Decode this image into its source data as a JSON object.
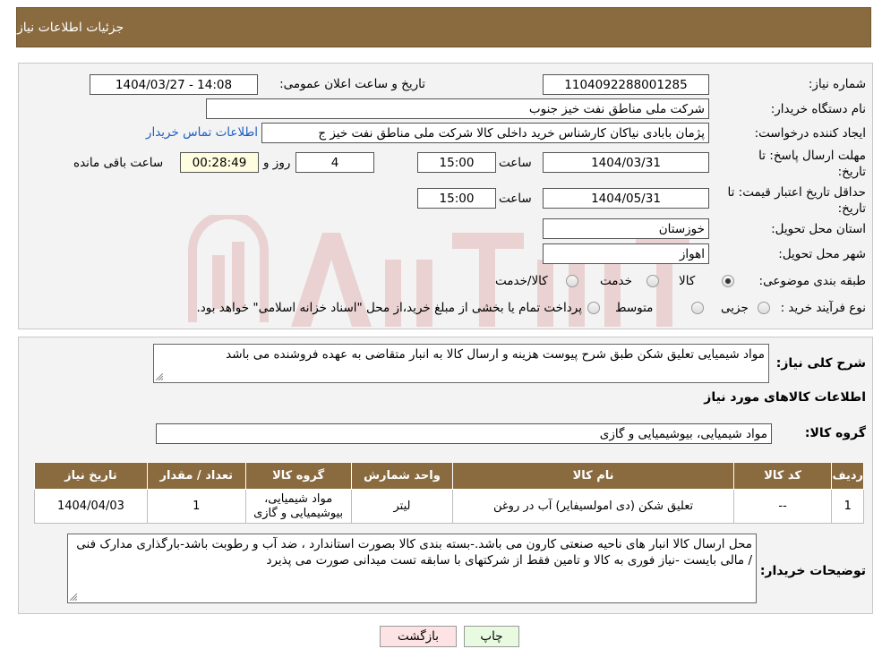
{
  "header": {
    "title": "جزئیات اطلاعات نیاز"
  },
  "need": {
    "number_label": "شماره نیاز:",
    "number": "1104092288001285",
    "announce_label": "تاریخ و ساعت اعلان عمومی:",
    "announce_value": "1404/03/27 - 14:08",
    "buyer_org_label": "نام دستگاه خریدار:",
    "buyer_org": "شرکت ملی مناطق نفت خیز جنوب",
    "creator_label": "ایجاد کننده درخواست:",
    "creator": "پژمان  بابادی نیاکان  کارشناس خرید داخلی کالا  شرکت ملی مناطق نفت خیز ج",
    "contact_link": "اطلاعات تماس خریدار",
    "deadline_label_1": "مهلت ارسال پاسخ: تا",
    "deadline_label_2": "تاریخ:",
    "deadline_date": "1404/03/31",
    "time_word": "ساعت",
    "deadline_time": "15:00",
    "days": "4",
    "days_and": "روز و",
    "remaining": "00:28:49",
    "remaining_label": "ساعت باقی مانده",
    "validity_label_1": "حداقل تاریخ اعتبار قیمت: تا",
    "validity_label_2": "تاریخ:",
    "validity_date": "1404/05/31",
    "validity_time": "15:00",
    "province_label": "استان محل تحویل:",
    "province": "خوزستان",
    "city_label": "شهر محل تحویل:",
    "city": "اهواز",
    "category_label": "طبقه بندی موضوعی:",
    "category_options": [
      "کالا",
      "خدمت",
      "کالا/خدمت"
    ],
    "process_label": "نوع فرآیند خرید :",
    "process_options": [
      "جزیی",
      "متوسط"
    ],
    "process_note": "پرداخت تمام یا بخشی از مبلغ خرید،از محل \"اسناد خزانه اسلامی\" خواهد بود."
  },
  "description": {
    "label": "شرح کلی نیاز:",
    "text": "مواد شیمیایی تعلیق شکن طبق شرح پیوست  هزینه و ارسال کالا به انبار متقاضی به عهده فروشنده  می باشد"
  },
  "goods": {
    "title": "اطلاعات کالاهای مورد نیاز",
    "group_label": "گروه کالا:",
    "group_value": "مواد شیمیایی، بیوشیمیایی و  گازی",
    "columns": [
      "ردیف",
      "کد کالا",
      "نام کالا",
      "واحد شمارش",
      "گروه کالا",
      "تعداد / مقدار",
      "تاریخ نیاز"
    ],
    "rows": [
      {
        "row": "1",
        "code": "--",
        "name": "تعلیق شکن (دی امولسیفایر) آب در روغن",
        "unit": "لیتر",
        "group": "مواد شیمیایی، بیوشیمیایی و گازی",
        "qty": "1",
        "date": "1404/04/03"
      }
    ]
  },
  "buyer_notes": {
    "label": "توضیحات خریدار:",
    "text": "محل ارسال کالا انبار های ناحیه صنعتی کارون می باشد.-بسته بندی کالا بصورت استاندارد ، ضد آب و رطوبت باشد-بارگذاری مدارک  فنی / مالی بایست  -نیاز فوری به کالا و تامین فقط از شرکتهای با سابقه تست میدانی صورت می پذیرد"
  },
  "actions": {
    "print": "چاپ",
    "back": "بازگشت"
  },
  "colors": {
    "header_bg": "#8a6a3f",
    "link": "#1a5ec2",
    "back_bg": "#fde3e3",
    "print_bg": "#e8fbe0",
    "yellow": "#fffde0"
  }
}
